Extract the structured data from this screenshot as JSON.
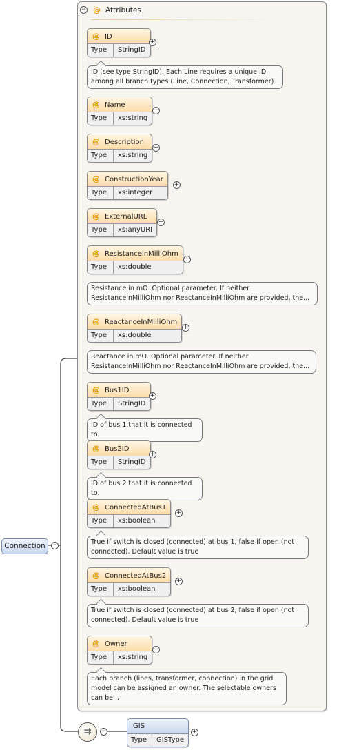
{
  "group": {
    "title": "Attributes",
    "collapse_glyph": "−",
    "at_glyph": "@"
  },
  "attributes": [
    {
      "name": "ID",
      "type_label": "Type",
      "type": "StringID",
      "doc": "ID (see type StringID). Each Line requires a unique ID among all branch types (Line, Connection, Transformer)."
    },
    {
      "name": "Name",
      "type_label": "Type",
      "type": "xs:string",
      "doc": ""
    },
    {
      "name": "Description",
      "type_label": "Type",
      "type": "xs:string",
      "doc": ""
    },
    {
      "name": "ConstructionYear",
      "type_label": "Type",
      "type": "xs:integer",
      "doc": ""
    },
    {
      "name": "ExternalURL",
      "type_label": "Type",
      "type": "xs:anyURI",
      "doc": ""
    },
    {
      "name": "ResistanceInMilliOhm",
      "type_label": "Type",
      "type": "xs:double",
      "doc": "Resistance in mΩ. Optional parameter. If neither ResistanceInMilliOhm nor ReactanceInMilliOhm are provided, the..."
    },
    {
      "name": "ReactanceInMilliOhm",
      "type_label": "Type",
      "type": "xs:double",
      "doc": "Reactance in mΩ. Optional parameter. If neither ResistanceInMilliOhm nor ReactanceInMilliOhm are provided, the..."
    },
    {
      "name": "Bus1ID",
      "type_label": "Type",
      "type": "StringID",
      "doc": "ID of bus 1 that it is connected to."
    },
    {
      "name": "Bus2ID",
      "type_label": "Type",
      "type": "StringID",
      "doc": "ID of bus 2 that it is connected to."
    },
    {
      "name": "ConnectedAtBus1",
      "type_label": "Type",
      "type": "xs:boolean",
      "doc": "True if switch is closed (connected) at bus 1, false if open (not connected). Default value is true"
    },
    {
      "name": "ConnectedAtBus2",
      "type_label": "Type",
      "type": "xs:boolean",
      "doc": "True if switch is closed (connected) at bus 2, false if open (not connected). Default value is true"
    },
    {
      "name": "Owner",
      "type_label": "Type",
      "type": "xs:string",
      "doc": "Each branch (lines, transformer, connection) in the grid model can be assigned an owner. The selectable owners can be..."
    }
  ],
  "root": {
    "name": "Connection",
    "collapse_glyph": "−"
  },
  "sequence": {
    "icon": "sequence-compositor-icon",
    "glyph": "⇉",
    "collapse_glyph": "−"
  },
  "child": {
    "name": "GIS",
    "type_label": "Type",
    "type": "GISType",
    "expand_glyph": "+"
  },
  "expand_glyph": "+"
}
